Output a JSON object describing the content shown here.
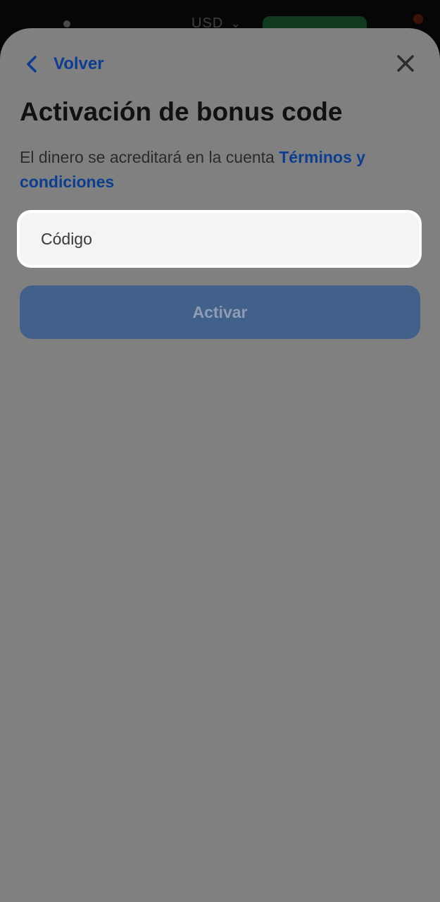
{
  "status_bar": {
    "currency": "USD",
    "currency_chevron": "chevron-down-icon"
  },
  "sheet": {
    "back_label": "Volver",
    "back_icon": "chevron-left-icon",
    "close_icon": "close-icon",
    "title": "Activación de bonus code",
    "subtitle_text": "El dinero se acreditará en la cuenta ",
    "terms_link": "Términos y condiciones",
    "code_input": {
      "placeholder": "Código",
      "value": ""
    },
    "activate_label": "Activar"
  },
  "colors": {
    "overlay_gray": "#808080",
    "link_blue": "#0b3d91",
    "button_disabled": "#41608a",
    "input_bg": "#f4f4f4"
  }
}
